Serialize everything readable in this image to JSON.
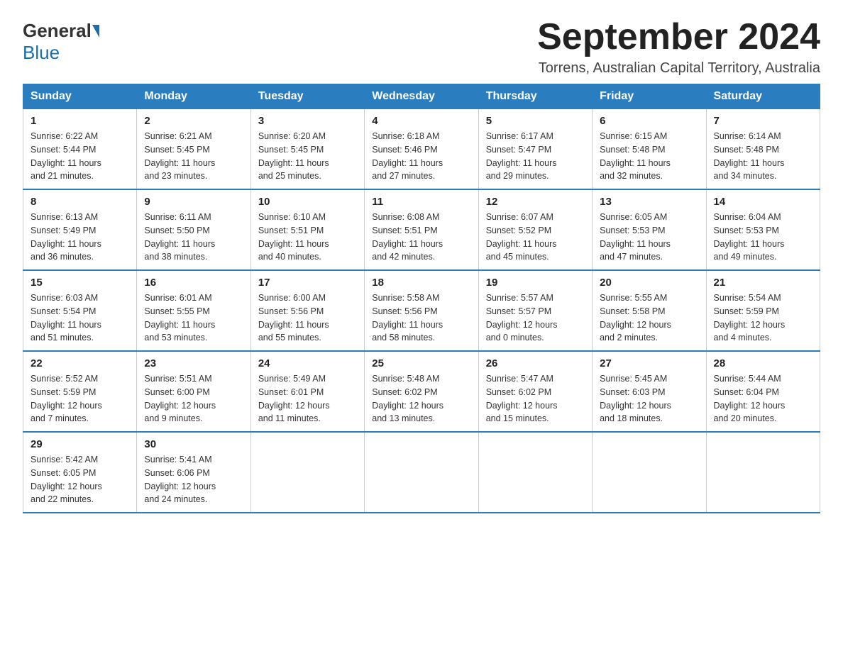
{
  "logo": {
    "general": "General",
    "blue": "Blue"
  },
  "header": {
    "month_year": "September 2024",
    "location": "Torrens, Australian Capital Territory, Australia"
  },
  "weekdays": [
    "Sunday",
    "Monday",
    "Tuesday",
    "Wednesday",
    "Thursday",
    "Friday",
    "Saturday"
  ],
  "weeks": [
    [
      {
        "day": "1",
        "sunrise": "6:22 AM",
        "sunset": "5:44 PM",
        "daylight": "11 hours and 21 minutes."
      },
      {
        "day": "2",
        "sunrise": "6:21 AM",
        "sunset": "5:45 PM",
        "daylight": "11 hours and 23 minutes."
      },
      {
        "day": "3",
        "sunrise": "6:20 AM",
        "sunset": "5:45 PM",
        "daylight": "11 hours and 25 minutes."
      },
      {
        "day": "4",
        "sunrise": "6:18 AM",
        "sunset": "5:46 PM",
        "daylight": "11 hours and 27 minutes."
      },
      {
        "day": "5",
        "sunrise": "6:17 AM",
        "sunset": "5:47 PM",
        "daylight": "11 hours and 29 minutes."
      },
      {
        "day": "6",
        "sunrise": "6:15 AM",
        "sunset": "5:48 PM",
        "daylight": "11 hours and 32 minutes."
      },
      {
        "day": "7",
        "sunrise": "6:14 AM",
        "sunset": "5:48 PM",
        "daylight": "11 hours and 34 minutes."
      }
    ],
    [
      {
        "day": "8",
        "sunrise": "6:13 AM",
        "sunset": "5:49 PM",
        "daylight": "11 hours and 36 minutes."
      },
      {
        "day": "9",
        "sunrise": "6:11 AM",
        "sunset": "5:50 PM",
        "daylight": "11 hours and 38 minutes."
      },
      {
        "day": "10",
        "sunrise": "6:10 AM",
        "sunset": "5:51 PM",
        "daylight": "11 hours and 40 minutes."
      },
      {
        "day": "11",
        "sunrise": "6:08 AM",
        "sunset": "5:51 PM",
        "daylight": "11 hours and 42 minutes."
      },
      {
        "day": "12",
        "sunrise": "6:07 AM",
        "sunset": "5:52 PM",
        "daylight": "11 hours and 45 minutes."
      },
      {
        "day": "13",
        "sunrise": "6:05 AM",
        "sunset": "5:53 PM",
        "daylight": "11 hours and 47 minutes."
      },
      {
        "day": "14",
        "sunrise": "6:04 AM",
        "sunset": "5:53 PM",
        "daylight": "11 hours and 49 minutes."
      }
    ],
    [
      {
        "day": "15",
        "sunrise": "6:03 AM",
        "sunset": "5:54 PM",
        "daylight": "11 hours and 51 minutes."
      },
      {
        "day": "16",
        "sunrise": "6:01 AM",
        "sunset": "5:55 PM",
        "daylight": "11 hours and 53 minutes."
      },
      {
        "day": "17",
        "sunrise": "6:00 AM",
        "sunset": "5:56 PM",
        "daylight": "11 hours and 55 minutes."
      },
      {
        "day": "18",
        "sunrise": "5:58 AM",
        "sunset": "5:56 PM",
        "daylight": "11 hours and 58 minutes."
      },
      {
        "day": "19",
        "sunrise": "5:57 AM",
        "sunset": "5:57 PM",
        "daylight": "12 hours and 0 minutes."
      },
      {
        "day": "20",
        "sunrise": "5:55 AM",
        "sunset": "5:58 PM",
        "daylight": "12 hours and 2 minutes."
      },
      {
        "day": "21",
        "sunrise": "5:54 AM",
        "sunset": "5:59 PM",
        "daylight": "12 hours and 4 minutes."
      }
    ],
    [
      {
        "day": "22",
        "sunrise": "5:52 AM",
        "sunset": "5:59 PM",
        "daylight": "12 hours and 7 minutes."
      },
      {
        "day": "23",
        "sunrise": "5:51 AM",
        "sunset": "6:00 PM",
        "daylight": "12 hours and 9 minutes."
      },
      {
        "day": "24",
        "sunrise": "5:49 AM",
        "sunset": "6:01 PM",
        "daylight": "12 hours and 11 minutes."
      },
      {
        "day": "25",
        "sunrise": "5:48 AM",
        "sunset": "6:02 PM",
        "daylight": "12 hours and 13 minutes."
      },
      {
        "day": "26",
        "sunrise": "5:47 AM",
        "sunset": "6:02 PM",
        "daylight": "12 hours and 15 minutes."
      },
      {
        "day": "27",
        "sunrise": "5:45 AM",
        "sunset": "6:03 PM",
        "daylight": "12 hours and 18 minutes."
      },
      {
        "day": "28",
        "sunrise": "5:44 AM",
        "sunset": "6:04 PM",
        "daylight": "12 hours and 20 minutes."
      }
    ],
    [
      {
        "day": "29",
        "sunrise": "5:42 AM",
        "sunset": "6:05 PM",
        "daylight": "12 hours and 22 minutes."
      },
      {
        "day": "30",
        "sunrise": "5:41 AM",
        "sunset": "6:06 PM",
        "daylight": "12 hours and 24 minutes."
      },
      null,
      null,
      null,
      null,
      null
    ]
  ],
  "labels": {
    "sunrise": "Sunrise: ",
    "sunset": "Sunset: ",
    "daylight": "Daylight: "
  }
}
